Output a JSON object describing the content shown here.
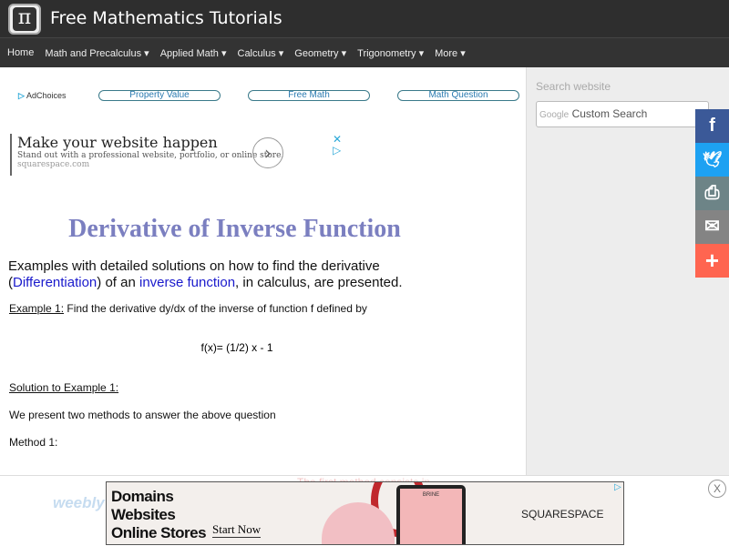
{
  "header": {
    "logo_glyph": "π",
    "title": "Free Mathematics Tutorials"
  },
  "nav": [
    "Home",
    "Math and Precalculus ▾",
    "Applied Math ▾",
    "Calculus ▾",
    "Geometry ▾",
    "Trigonometry ▾",
    "More ▾"
  ],
  "ad_links": {
    "adchoices": "AdChoices",
    "links": [
      "Property Value",
      "Free Math",
      "Math Question"
    ]
  },
  "ad1": {
    "headline": "Make your website happen",
    "sub": "Stand out with a professional website, portfolio, or online store.",
    "url": "squarespace.com"
  },
  "article": {
    "title": "Derivative of Inverse Function",
    "intro_pre": "Examples with detailed solutions on how to find the derivative (",
    "link1": "Differentiation",
    "intro_mid": ") of an ",
    "link2": "inverse function",
    "intro_post": ", in calculus, are presented.",
    "ex1_label": "Example 1:",
    "ex1_text": " Find the derivative dy/dx of the inverse of function f defined by",
    "formula": "f(x)= (1/2) x - 1",
    "solution_label": "Solution to Example 1:",
    "present": "We present two methods to answer the above question",
    "method1": "Method 1:",
    "faded": "The first method consists in"
  },
  "sidebar": {
    "search_label": "Search website",
    "google": "Google",
    "search_placeholder": "Custom Search"
  },
  "share": [
    {
      "icon": "facebook-icon",
      "glyph": "f",
      "color": "#3b5998"
    },
    {
      "icon": "twitter-icon",
      "glyph": "🐦",
      "color": "#1da1f2"
    },
    {
      "icon": "print-icon",
      "glyph": "⎙",
      "color": "#6d8487"
    },
    {
      "icon": "email-icon",
      "glyph": "✉",
      "color": "#848484"
    },
    {
      "icon": "plus-icon",
      "glyph": "+",
      "color": "#ff6550"
    }
  ],
  "ad2": {
    "brand_faint": "weebly",
    "line1": "Domains",
    "line2": "Websites",
    "line3": "Online Stores",
    "cta": "Start Now",
    "sponsor": "SQUARESPACE",
    "mock": "BRINE",
    "close": "X"
  }
}
